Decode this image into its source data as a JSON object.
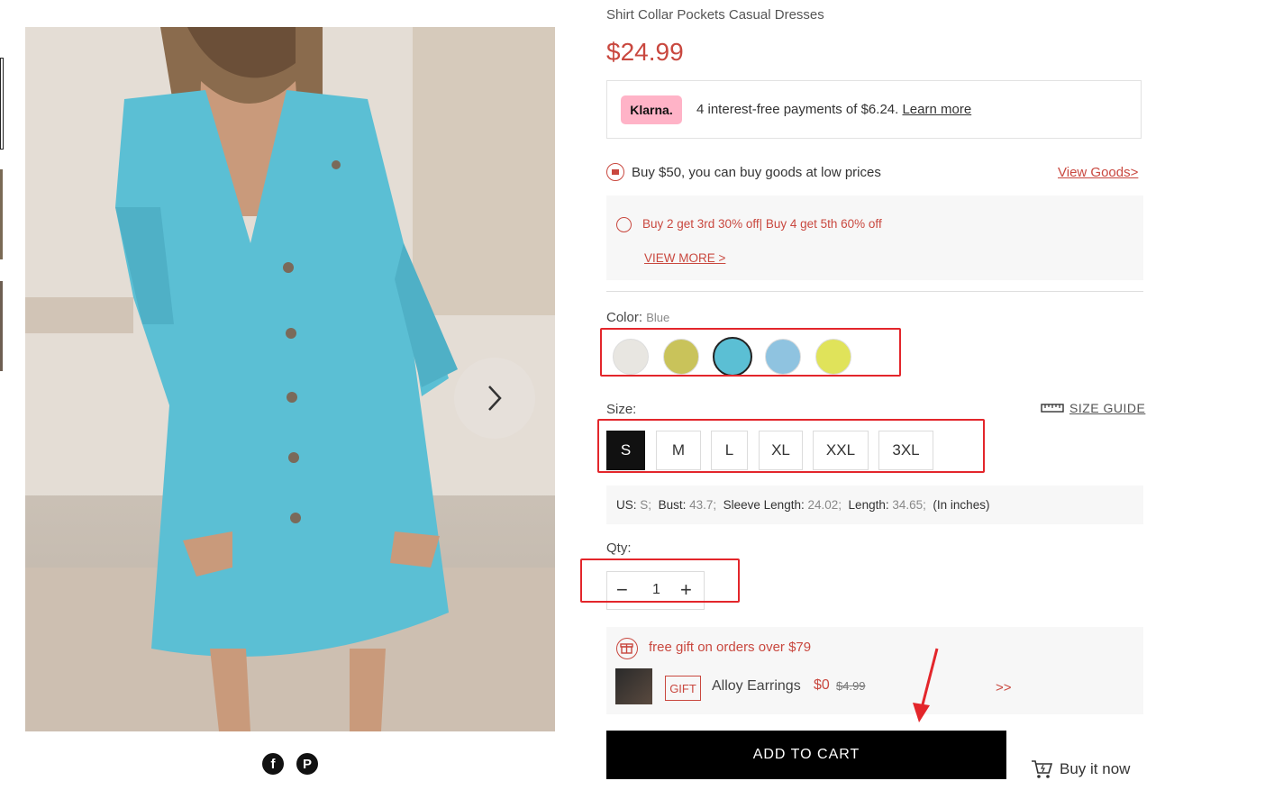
{
  "product": {
    "title": "Shirt Collar Pockets Casual Dresses",
    "price": "$24.99",
    "image_color": "#5bbfd4"
  },
  "klarna": {
    "logo": "Klarna.",
    "text": "4 interest-free payments of $6.24.",
    "link": "Learn more"
  },
  "promo": {
    "text": "Buy $50, you can buy goods at low prices",
    "link": "View Goods>"
  },
  "offer": {
    "text": "Buy 2 get 3rd 30% off| Buy 4 get 5th 60% off",
    "link": "VIEW MORE >"
  },
  "color": {
    "label": "Color:",
    "selected": "Blue",
    "swatches": [
      {
        "name": "white",
        "color": "#e8e6e1"
      },
      {
        "name": "yellow-green",
        "color": "#c9c35a"
      },
      {
        "name": "blue",
        "color": "#5bbfd4"
      },
      {
        "name": "light-blue",
        "color": "#8fc3e0"
      },
      {
        "name": "yellow",
        "color": "#e0e35a"
      }
    ]
  },
  "size": {
    "label": "Size:",
    "guide": "SIZE GUIDE",
    "options": [
      "S",
      "M",
      "L",
      "XL",
      "XXL",
      "3XL"
    ],
    "selected": "S"
  },
  "measurements": {
    "us_label": "US:",
    "us_value": "S;",
    "bust_label": "Bust:",
    "bust_value": "43.7;",
    "sleeve_label": "Sleeve Length:",
    "sleeve_value": "24.02;",
    "length_label": "Length:",
    "length_value": "34.65;",
    "unit": "(In inches)"
  },
  "qty": {
    "label": "Qty:",
    "value": "1",
    "minus": "−",
    "plus": "+"
  },
  "gift": {
    "headline": "free gift on orders over $79",
    "tag": "GIFT",
    "name": "Alloy Earrings",
    "price": "$0",
    "old_price": "$4.99",
    "more": ">>"
  },
  "actions": {
    "add_to_cart": "ADD TO CART",
    "buy_now": "Buy it now"
  },
  "social": {
    "facebook": "f",
    "pinterest": "P"
  },
  "colors": {
    "accent": "#c9483f",
    "annotation_red": "#e3262b",
    "klarna_pink": "#ffb3c7"
  }
}
